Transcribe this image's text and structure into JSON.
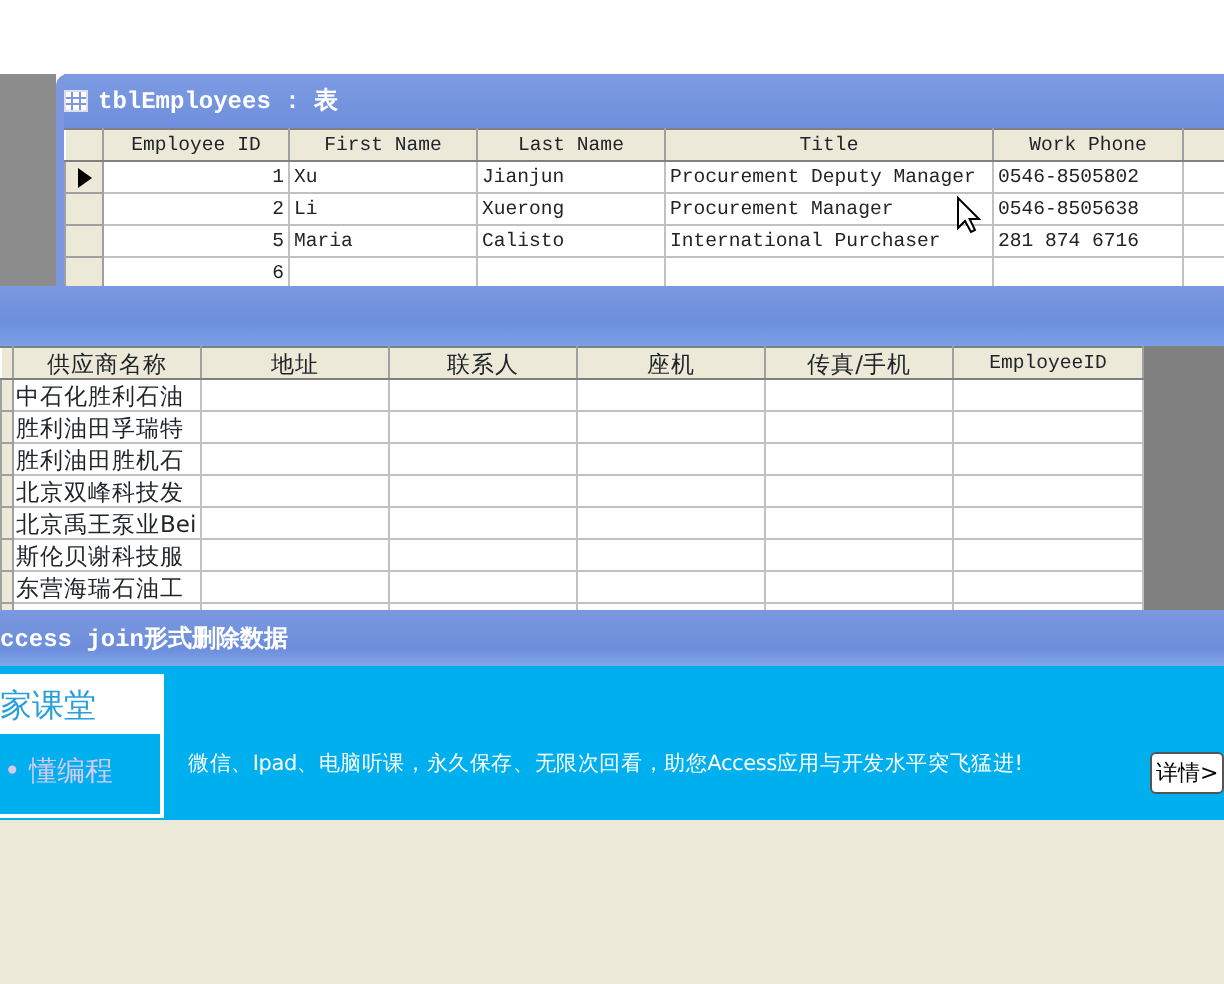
{
  "employees_window": {
    "title": "tblEmployees : 表",
    "columns": [
      "Employee ID",
      "First Name",
      "Last Name",
      "Title",
      "Work Phone"
    ],
    "rows": [
      {
        "current": true,
        "cells": [
          "1",
          "Xu",
          "Jianjun",
          "Procurement Deputy Manager",
          "0546-8505802"
        ]
      },
      {
        "current": false,
        "cells": [
          "2",
          "Li",
          "Xuerong",
          "Procurement Manager",
          "0546-8505638"
        ]
      },
      {
        "current": false,
        "cells": [
          "5",
          "Maria",
          "Calisto",
          "International Purchaser",
          "281 874 6716"
        ]
      },
      {
        "current": false,
        "cells": [
          "6"
        ]
      }
    ]
  },
  "suppliers_window": {
    "columns": [
      "供应商名称",
      "地址",
      "联系人",
      "座机",
      "传真/手机",
      "EmployeeID"
    ],
    "rows": [
      "中石化胜利石油",
      "胜利油田孚瑞特",
      "胜利油田胜机石",
      "北京双峰科技发",
      "北京禹王泵业Bei",
      "斯伦贝谢科技服",
      "东营海瑞石油工"
    ]
  },
  "ad_window": {
    "title": "ccess join形式删除数据",
    "brand": "家课堂",
    "tagline": "• 懂编程",
    "message": "微信、Ipad、电脑听课，永久保存、无限次回看，助您Access应用与开发水平突飞猛进!",
    "button": "详情>"
  }
}
